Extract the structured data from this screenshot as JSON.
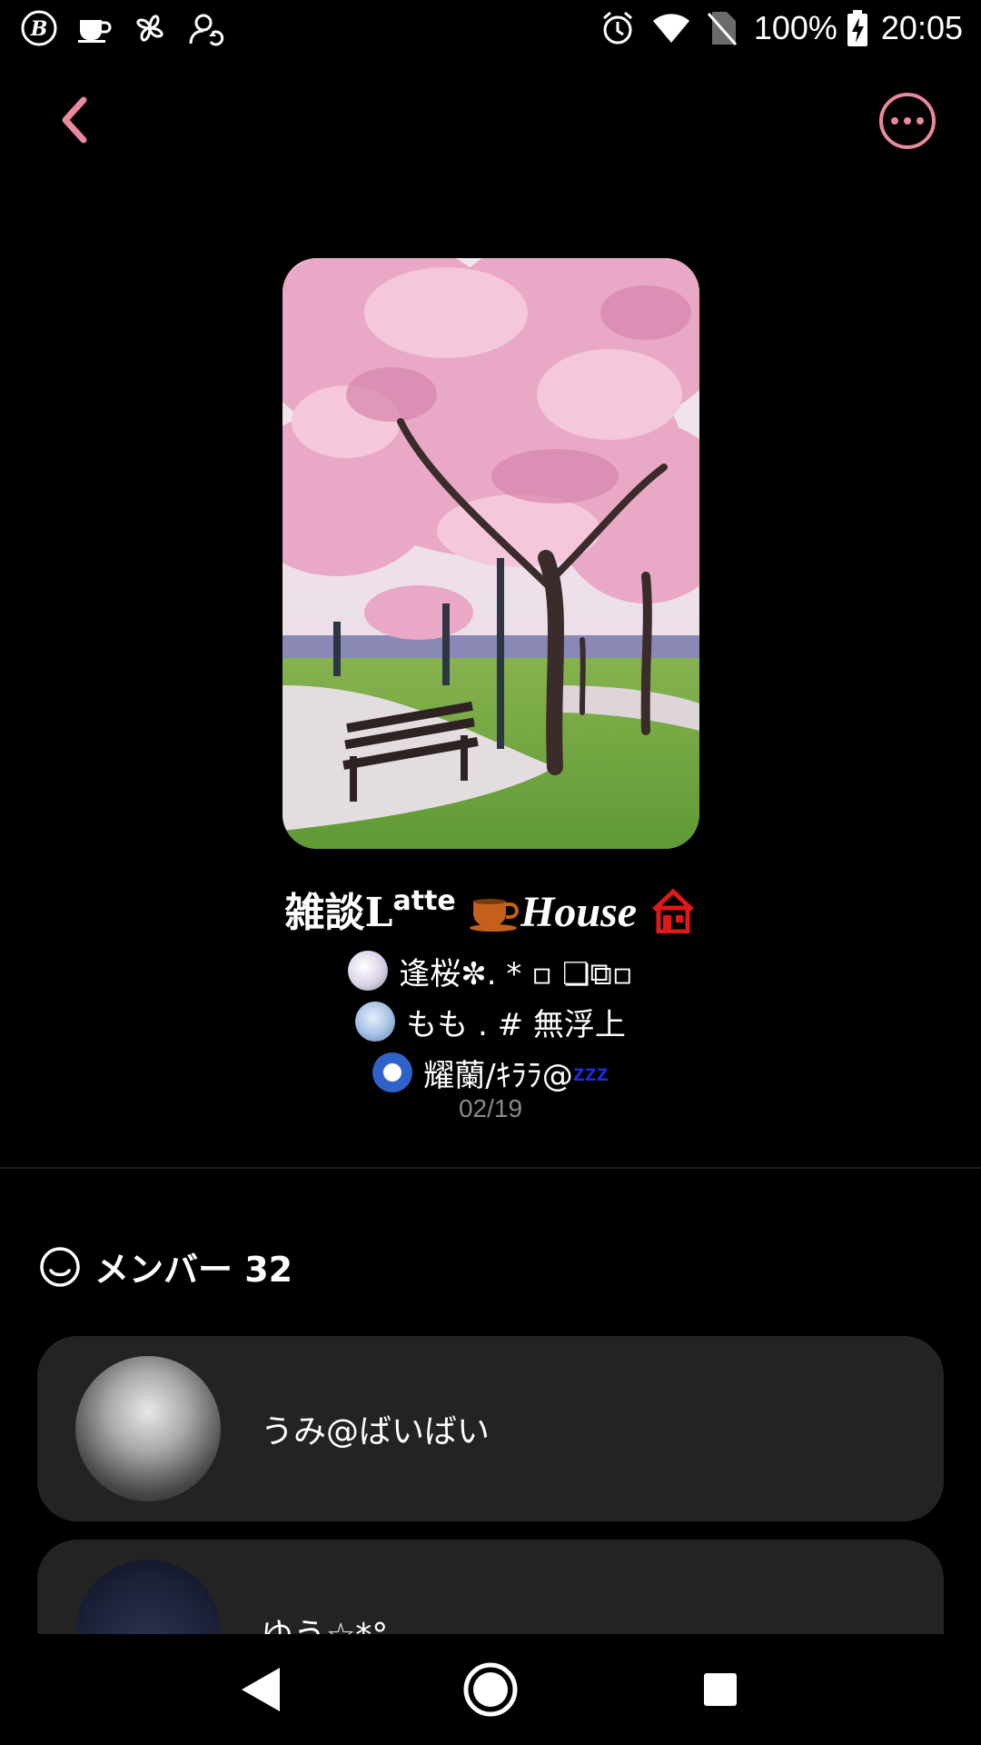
{
  "status_bar": {
    "battery": "100%",
    "time": "20:05"
  },
  "chat": {
    "title_main": "雑談L",
    "title_sup": "atte",
    "title_house": "House",
    "date": "02/19",
    "preview_members": [
      {
        "name": "逢桜✼. * ▫ ❏⧉▫"
      },
      {
        "name": "もも . # 無浮上"
      },
      {
        "name": "耀蘭/ｷﾗﾗ@",
        "suffix": "zzz",
        "suffix_color": "#1c2bd6"
      }
    ]
  },
  "members_section": {
    "label": "メンバー 32"
  },
  "members": [
    {
      "name": "うみ@ばいばい"
    },
    {
      "name": "ゆう☆*°"
    }
  ],
  "colors": {
    "accent": "#e88a9c",
    "card_bg": "#232323",
    "background": "#000000"
  },
  "icons": {
    "back": "back-chevron-icon",
    "more": "more-options-icon",
    "members": "smiley-icon"
  }
}
